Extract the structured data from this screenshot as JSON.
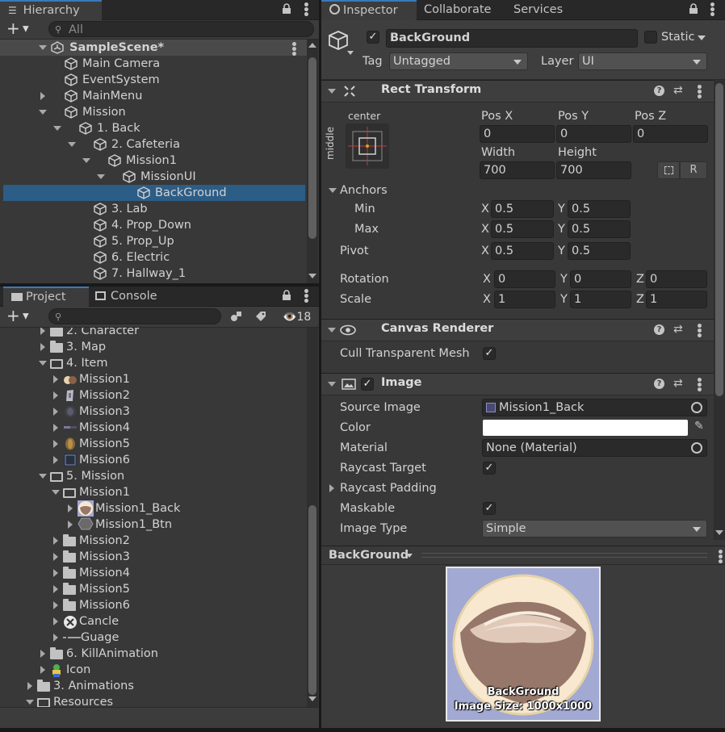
{
  "hierarchy": {
    "tab_label": "Hierarchy",
    "add_label": "+",
    "search_placeholder": "All",
    "scene_name": "SampleScene*",
    "items": [
      {
        "label": "Main Camera"
      },
      {
        "label": "EventSystem"
      },
      {
        "label": "MainMenu"
      },
      {
        "label": "Mission"
      },
      {
        "label": "1. Back"
      },
      {
        "label": "2. Cafeteria"
      },
      {
        "label": "Mission1"
      },
      {
        "label": "MissionUI"
      },
      {
        "label": "BackGround"
      },
      {
        "label": "3. Lab"
      },
      {
        "label": "4. Prop_Down"
      },
      {
        "label": "5. Prop_Up"
      },
      {
        "label": "6. Electric"
      },
      {
        "label": "7. Hallway_1"
      }
    ]
  },
  "project": {
    "tab_project": "Project",
    "tab_console": "Console",
    "add_label": "+",
    "hidden_count": "18",
    "items": [
      {
        "label": "2. Character"
      },
      {
        "label": "3. Map"
      },
      {
        "label": "4. Item"
      },
      {
        "label": "Mission1"
      },
      {
        "label": "Mission2"
      },
      {
        "label": "Mission3"
      },
      {
        "label": "Mission4"
      },
      {
        "label": "Mission5"
      },
      {
        "label": "Mission6"
      },
      {
        "label": "5. Mission"
      },
      {
        "label": "Mission1"
      },
      {
        "label": "Mission1_Back"
      },
      {
        "label": "Mission1_Btn"
      },
      {
        "label": "Mission2"
      },
      {
        "label": "Mission3"
      },
      {
        "label": "Mission4"
      },
      {
        "label": "Mission5"
      },
      {
        "label": "Mission6"
      },
      {
        "label": "Cancle"
      },
      {
        "label": "Guage"
      },
      {
        "label": "6. KillAnimation"
      },
      {
        "label": "Icon"
      },
      {
        "label": "3. Animations"
      },
      {
        "label": "Resources"
      }
    ]
  },
  "inspector": {
    "tab_inspector": "Inspector",
    "tab_collaborate": "Collaborate",
    "tab_services": "Services",
    "object_name": "BackGround",
    "static_label": "Static",
    "tag_label": "Tag",
    "tag_value": "Untagged",
    "layer_label": "Layer",
    "layer_value": "UI",
    "rect_transform": {
      "title": "Rect Transform",
      "anchor_h": "center",
      "anchor_v": "middle",
      "pos_x_label": "Pos X",
      "pos_y_label": "Pos Y",
      "pos_z_label": "Pos Z",
      "pos_x": "0",
      "pos_y": "0",
      "pos_z": "0",
      "width_label": "Width",
      "height_label": "Height",
      "width": "700",
      "height": "700",
      "r_label": "R",
      "anchors_label": "Anchors",
      "min_label": "Min",
      "max_label": "Max",
      "min_x": "0.5",
      "min_y": "0.5",
      "max_x": "0.5",
      "max_y": "0.5",
      "pivot_label": "Pivot",
      "pivot_x": "0.5",
      "pivot_y": "0.5",
      "rotation_label": "Rotation",
      "rot_x": "0",
      "rot_y": "0",
      "rot_z": "0",
      "scale_label": "Scale",
      "scale_x": "1",
      "scale_y": "1",
      "scale_z": "1",
      "x": "X",
      "y": "Y",
      "z": "Z"
    },
    "canvas_renderer": {
      "title": "Canvas Renderer",
      "cull_label": "Cull Transparent Mesh"
    },
    "image": {
      "title": "Image",
      "source_image_label": "Source Image",
      "source_image_value": "Mission1_Back",
      "color_label": "Color",
      "color_value": "#ffffff",
      "material_label": "Material",
      "material_value": "None (Material)",
      "raycast_target_label": "Raycast Target",
      "raycast_padding_label": "Raycast Padding",
      "maskable_label": "Maskable",
      "image_type_label": "Image Type",
      "image_type_value": "Simple"
    },
    "preview": {
      "title": "BackGround",
      "name": "BackGround",
      "size": "Image Size: 1000x1000",
      "bg_color": "#a2a9d2"
    }
  },
  "colors": {
    "selection": "#2c5d87",
    "accent_tab": "#3a79bb",
    "panel_bg": "#383838"
  }
}
